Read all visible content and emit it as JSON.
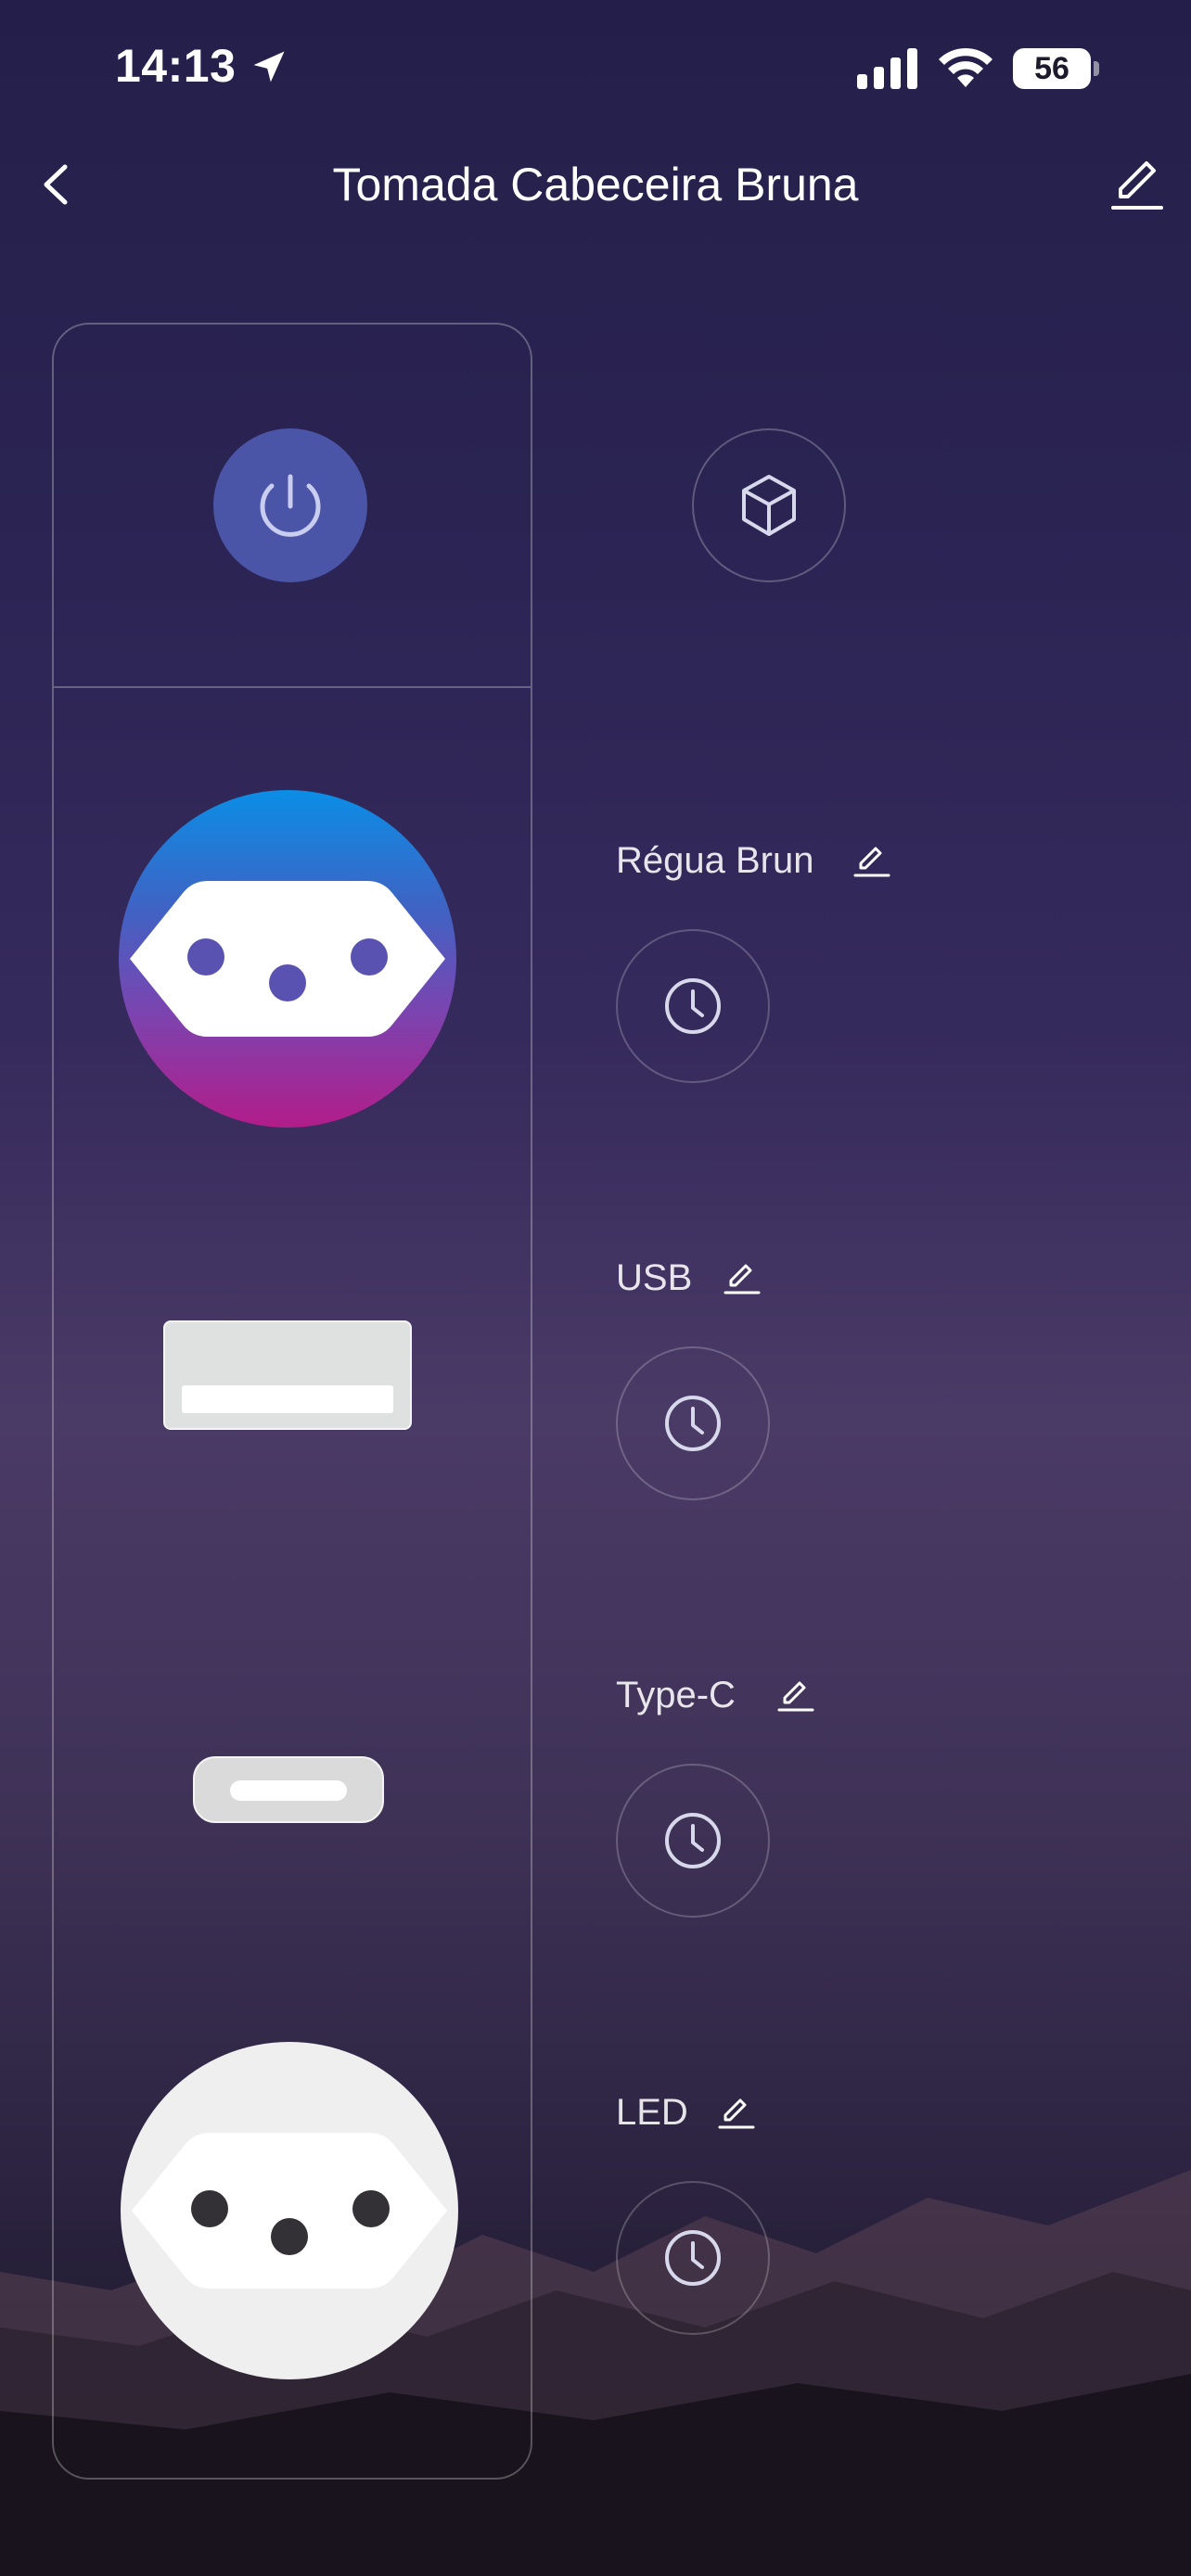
{
  "status_bar": {
    "time": "14:13",
    "battery": "56"
  },
  "header": {
    "title": "Tomada Cabeceira Bruna",
    "back_icon": "chevron-left-icon",
    "edit_icon": "pencil-icon"
  },
  "panel": {
    "power_icon": "power-icon",
    "scene_icon": "cube-icon",
    "power_color": "#4b55a8"
  },
  "channels": [
    {
      "label": "Régua Brun",
      "type": "outlet",
      "state": "on"
    },
    {
      "label": "USB",
      "type": "usb-a",
      "state": "off"
    },
    {
      "label": "Type-C",
      "type": "usb-c",
      "state": "off"
    },
    {
      "label": "LED",
      "type": "outlet",
      "state": "off"
    }
  ]
}
